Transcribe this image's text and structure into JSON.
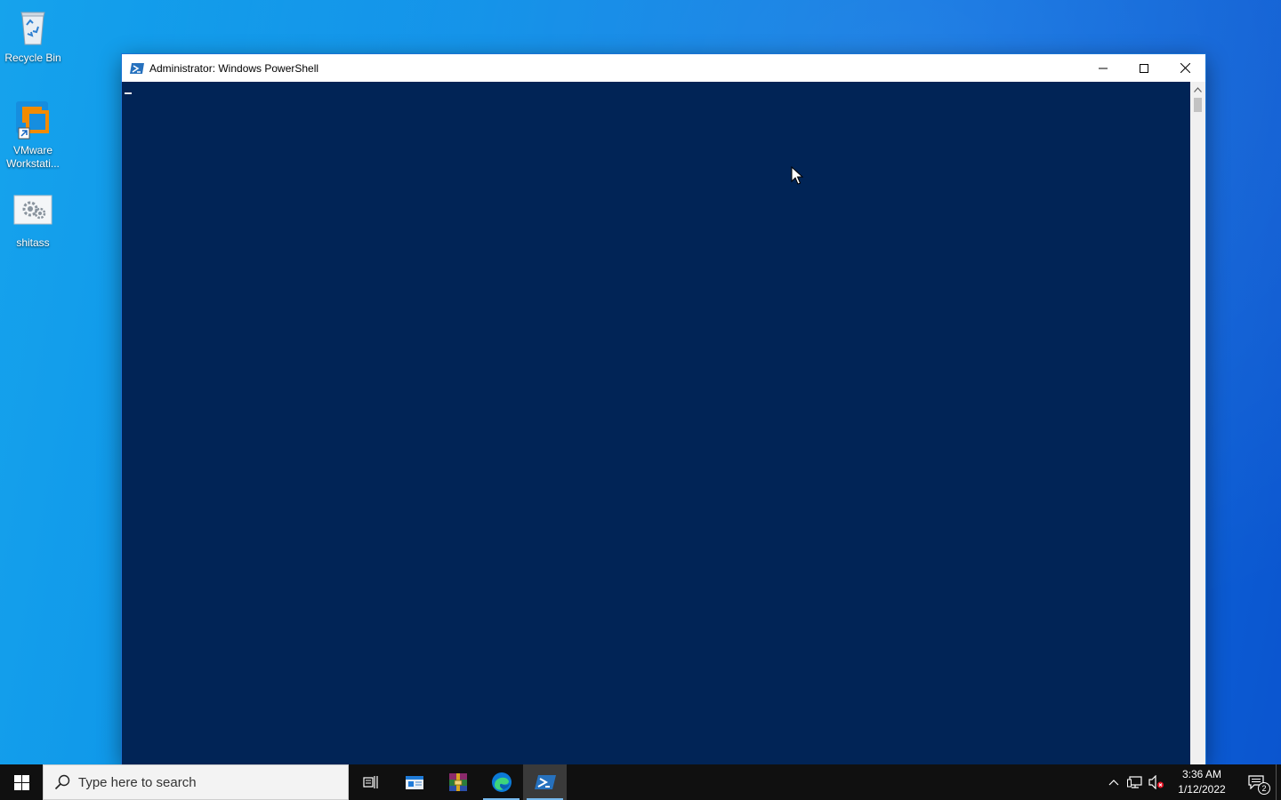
{
  "desktop": {
    "icons": [
      {
        "label": "Recycle Bin",
        "icon": "recycle-bin-icon"
      },
      {
        "label": "VMware Workstati...",
        "icon": "vmware-icon"
      },
      {
        "label": "shitass",
        "icon": "settings-file-icon"
      }
    ]
  },
  "window": {
    "title": "Administrator: Windows PowerShell",
    "icon": "powershell-icon",
    "background_color": "#012456",
    "buttons": {
      "minimize": "minimize-icon",
      "maximize": "maximize-icon",
      "close": "close-icon"
    }
  },
  "taskbar": {
    "search_placeholder": "Type here to search",
    "apps": [
      {
        "name": "task-view",
        "icon": "task-view-icon"
      },
      {
        "name": "file-explorer",
        "icon": "file-explorer-icon"
      },
      {
        "name": "winrar",
        "icon": "winrar-icon"
      },
      {
        "name": "edge",
        "icon": "edge-icon",
        "running": true
      },
      {
        "name": "powershell",
        "icon": "powershell-icon",
        "running": true,
        "active": true
      }
    ],
    "tray": {
      "time": "3:36 AM",
      "date": "1/12/2022",
      "notification_count": "2"
    }
  }
}
